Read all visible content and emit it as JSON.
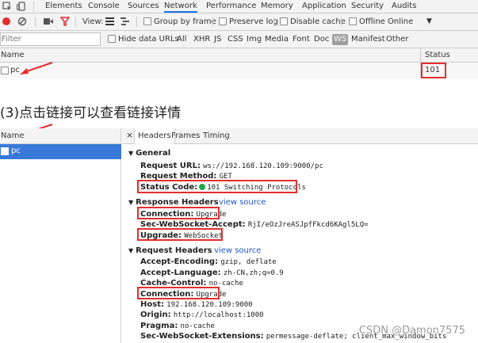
{
  "devtools": {
    "tabs": [
      "Elements",
      "Console",
      "Sources",
      "Network",
      "Performance",
      "Memory",
      "Application",
      "Security",
      "Audits"
    ],
    "active_tab": "Network",
    "toolbar": {
      "view_label": "View:",
      "group_by_frame": "Group by frame",
      "preserve_log": "Preserve log",
      "disable_cache": "Disable cache",
      "offline": "Offline",
      "throttle": "Online"
    },
    "filter": {
      "placeholder": "Filter",
      "hide_data_urls": "Hide data URLs",
      "types": [
        "All",
        "XHR",
        "JS",
        "CSS",
        "Img",
        "Media",
        "Font",
        "Doc",
        "WS",
        "Manifest",
        "Other"
      ],
      "active_type": "WS"
    },
    "table": {
      "col_name": "Name",
      "col_status": "Status",
      "rows": [
        {
          "name": "pc",
          "status": "101"
        }
      ]
    }
  },
  "caption": "(3)点击链接可以查看链接详情",
  "detail": {
    "list_header": "Name",
    "list_items": [
      "pc"
    ],
    "tabs": [
      "Headers",
      "Frames",
      "Timing"
    ],
    "active_tab": "Headers",
    "view_source": "view source",
    "general": {
      "title": "General",
      "request_url_key": "Request URL:",
      "request_url": "ws://192.168.120.109:9000/pc",
      "method_key": "Request Method:",
      "method": "GET",
      "status_key": "Status Code:",
      "status": "101 Switching Protocols"
    },
    "response_headers": {
      "title": "Response Headers",
      "connection_key": "Connection:",
      "connection": "Upgrade",
      "accept_key": "Sec-WebSocket-Accept:",
      "accept": "RjI/eOzJreASJpfFkcd6KAgl5LQ=",
      "upgrade_key": "Upgrade:",
      "upgrade": "WebSocket"
    },
    "request_headers": {
      "title": "Request Headers",
      "encoding_key": "Accept-Encoding:",
      "encoding": "gzip, deflate",
      "language_key": "Accept-Language:",
      "language": "zh-CN,zh;q=0.9",
      "cache_key": "Cache-Control:",
      "cache": "no-cache",
      "connection_key": "Connection:",
      "connection": "Upgrade",
      "host_key": "Host:",
      "host": "192.168.120.109:9000",
      "origin_key": "Origin:",
      "origin": "http://localhost:1000",
      "pragma_key": "Pragma:",
      "pragma": "no-cache",
      "extensions_key": "Sec-WebSocket-Extensions:",
      "extensions": "permessage-deflate; client_max_window_bits"
    }
  },
  "watermark": "CSDN @Damon7575",
  "colors": {
    "highlight": "#e32e2e",
    "accent": "#1a73e8",
    "selected_row": "#3879d9",
    "status_dot": "#1fa84c"
  }
}
